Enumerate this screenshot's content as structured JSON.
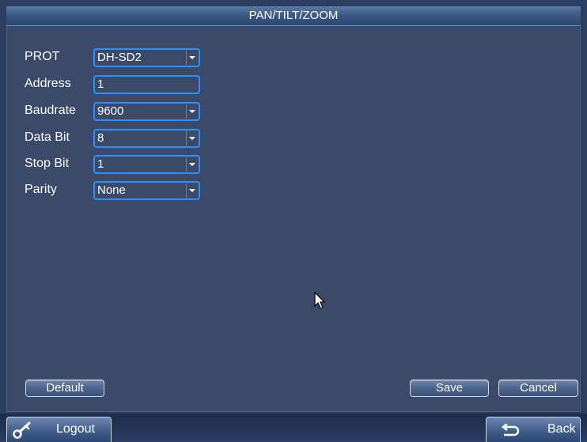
{
  "window": {
    "title": "PAN/TILT/ZOOM"
  },
  "form": {
    "fields": [
      {
        "label": "PROT",
        "value": "DH-SD2",
        "type": "dropdown"
      },
      {
        "label": "Address",
        "value": "1",
        "type": "text"
      },
      {
        "label": "Baudrate",
        "value": "9600",
        "type": "dropdown"
      },
      {
        "label": "Data Bit",
        "value": "8",
        "type": "dropdown"
      },
      {
        "label": "Stop Bit",
        "value": "1",
        "type": "dropdown"
      },
      {
        "label": "Parity",
        "value": "None",
        "type": "dropdown"
      }
    ]
  },
  "actions": {
    "default_label": "Default",
    "save_label": "Save",
    "cancel_label": "Cancel"
  },
  "bottom_bar": {
    "logout_label": "Logout",
    "back_label": "Back",
    "logout_icon": "key-icon",
    "back_icon": "return-arrow-icon"
  },
  "colors": {
    "panel_background": "#3b4a68",
    "field_border": "#2a8fff",
    "title_bar": "#3d5b86"
  }
}
